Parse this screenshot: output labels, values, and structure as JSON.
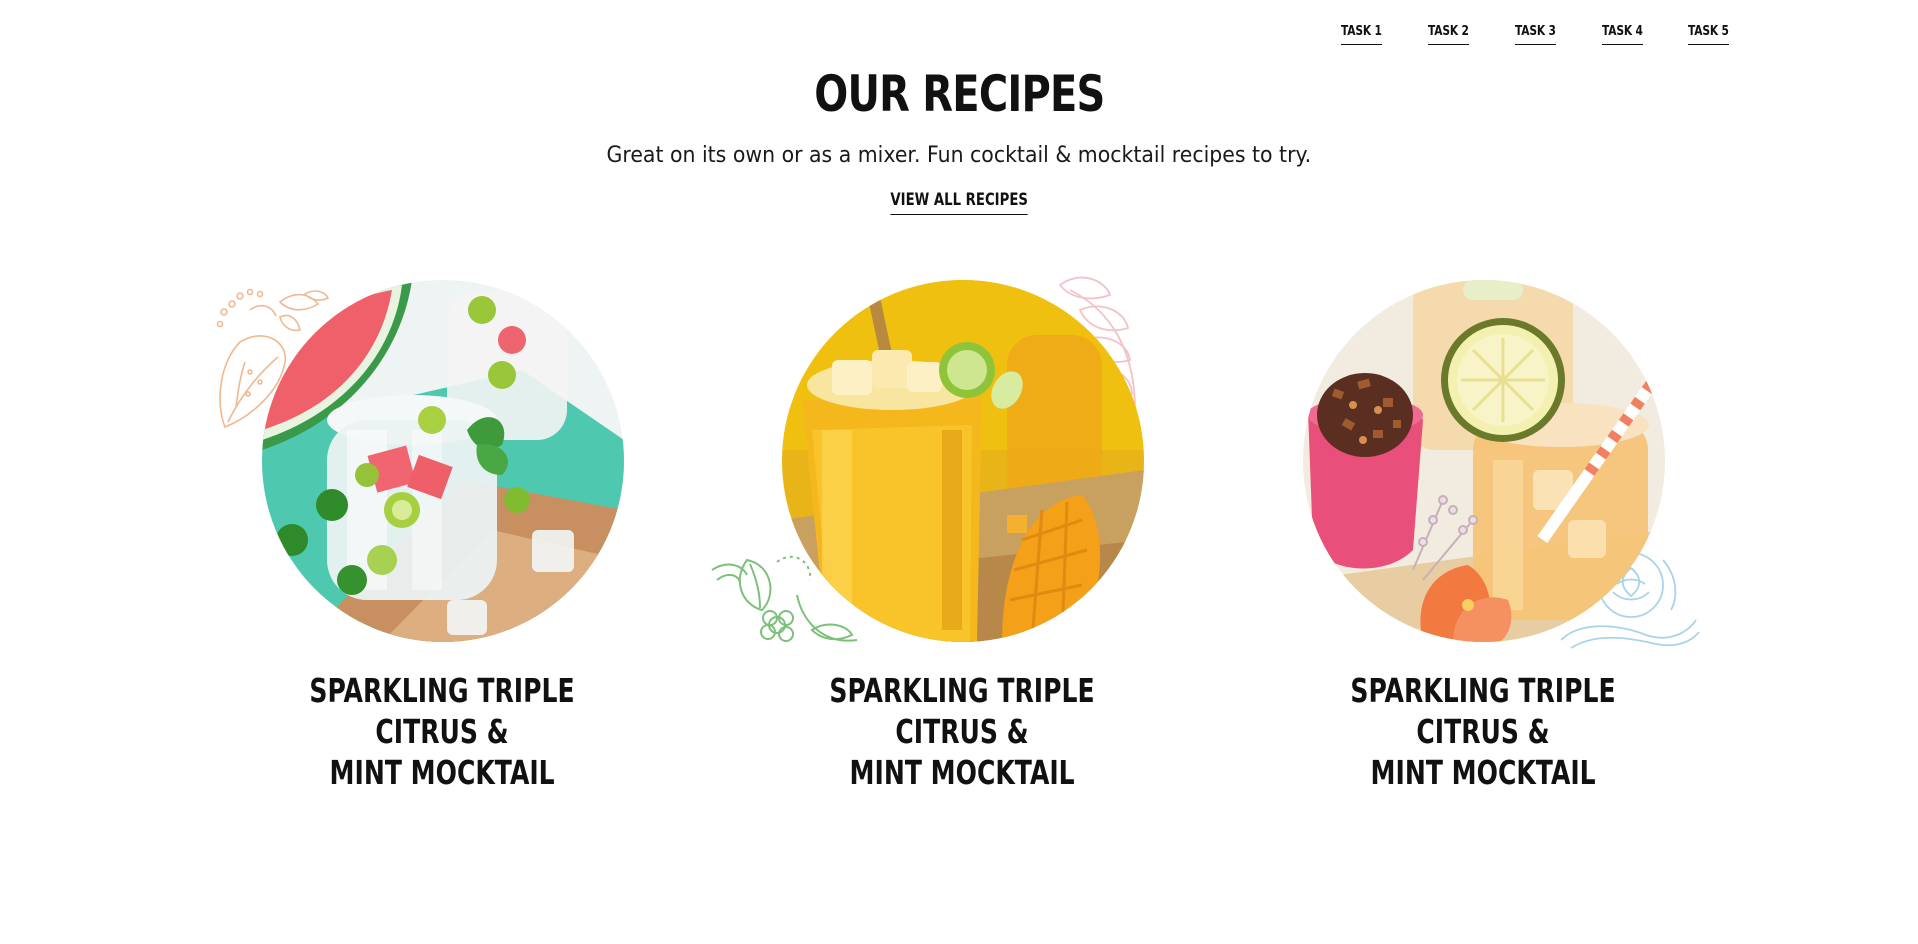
{
  "nav": {
    "tasks": [
      "TASK 1",
      "TASK 2",
      "TASK 3",
      "TASK 4",
      "TASK 5"
    ]
  },
  "header": {
    "title": "OUR RECIPES",
    "subtitle": "Great on its own or as a mixer. Fun cocktail & mocktail recipes to try.",
    "view_all_label": "VIEW ALL RECIPES"
  },
  "recipes": [
    {
      "title_line1": "SPARKLING TRIPLE CITRUS &",
      "title_line2": "MINT MOCKTAIL",
      "image": "watermelon-lime-mint-drink-photo",
      "doodle": "mango-leaf-doodle-icon"
    },
    {
      "title_line1": "SPARKLING TRIPLE CITRUS &",
      "title_line2": "MINT MOCKTAIL",
      "image": "mango-lime-drink-photo",
      "doodle": "green-leaf-flower-doodle-icon"
    },
    {
      "title_line1": "SPARKLING TRIPLE CITRUS &",
      "title_line2": "MINT MOCKTAIL",
      "image": "iced-tea-lemon-drink-photo",
      "doodle": "blue-flower-doodle-icon"
    }
  ],
  "colors": {
    "text": "#111111",
    "background": "#ffffff",
    "doodle_orange": "#f0b890",
    "doodle_pink": "#f2c2c8",
    "doodle_green": "#7cc07a",
    "doodle_blue": "#a8d4ea"
  }
}
